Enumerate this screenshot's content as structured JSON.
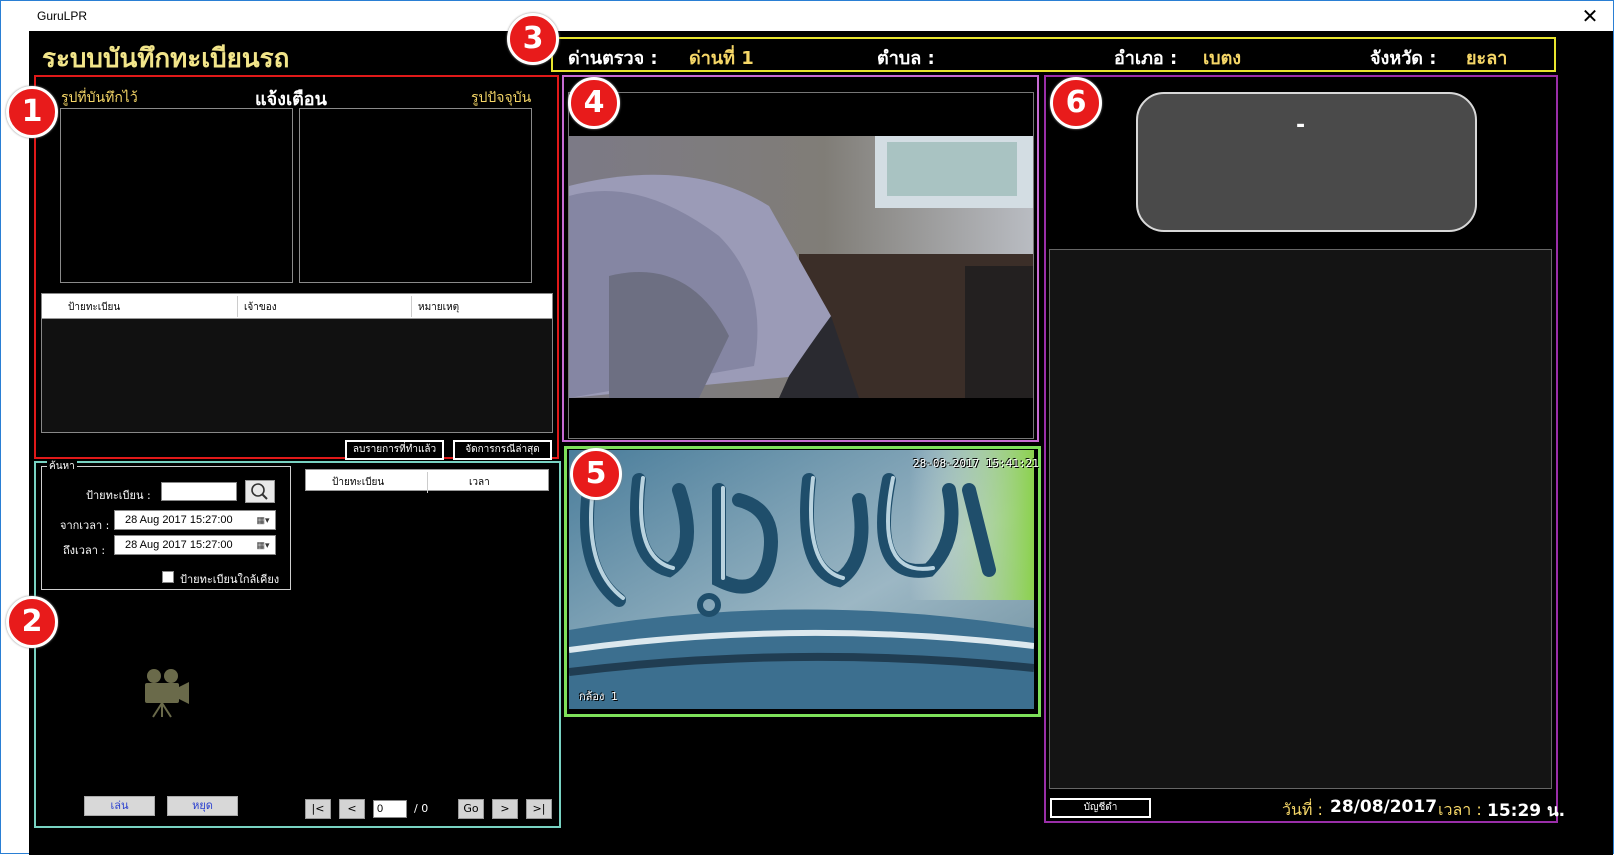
{
  "window": {
    "title": "GuruLPR",
    "close_glyph": "✕"
  },
  "app": {
    "title": "ระบบบันทึกทะเบียนรถ"
  },
  "location": {
    "checkpoint_label": "ด่านตรวจ :",
    "checkpoint_value": "ด่านที่ 1",
    "subdistrict_label": "ตำบล :",
    "subdistrict_value": "",
    "district_label": "อำเภอ :",
    "district_value": "เบตง",
    "province_label": "จังหวัด :",
    "province_value": "ยะลา"
  },
  "callouts": [
    "1",
    "2",
    "3",
    "4",
    "5",
    "6"
  ],
  "alert": {
    "saved_image_label": "รูปที่บันทึกไว้",
    "title": "แจ้งเตือน",
    "current_image_label": "รูปปัจจุบัน",
    "columns": [
      "ป้ายทะเบียน",
      "เจ้าของ",
      "หมายเหตุ"
    ],
    "delete_done_button": "ลบรายการที่ทำแล้ว",
    "manage_latest_button": "จัดการกรณีล่าสุด"
  },
  "search": {
    "group_title": "ค้นหา",
    "plate_label": "ป้ายทะเบียน :",
    "plate_value": "",
    "from_label": "จากเวลา :",
    "from_value": "28 Aug 2017   15:27:00",
    "to_label": "ถึงเวลา :",
    "to_value": "28 Aug 2017   15:27:00",
    "similar_plate_label": "ป้ายทะเบียนใกล้เคียง",
    "result_columns": [
      "ป้ายทะเบียน",
      "เวลา"
    ],
    "play_button": "เล่น",
    "stop_button": "หยุด",
    "first_button": "|<",
    "prev_button": "<",
    "page_value": "0",
    "page_total": "/ 0",
    "go_button": "Go",
    "next_button": ">",
    "last_button": ">|"
  },
  "camera": {
    "timestamp": "28-08-2017 15:41:21",
    "name": "กล้อง 1"
  },
  "plate_panel": {
    "plate_text": "-",
    "blacklist_button": "บัญชีดำ",
    "date_label": "วันที่ :",
    "date_value": "28/08/2017",
    "time_label": "เวลา :",
    "time_value": "15:29 น."
  },
  "colors": {
    "panel1": "#e01919",
    "panel2": "#78d2c2",
    "panel3": "#e8e52d",
    "panel4": "#c76bd3",
    "panel5": "#7ee05a",
    "panel6": "#9a2ea8",
    "callout": "#e81b1b",
    "accent_yellow": "#f5d667"
  },
  "icons": [
    "close-icon",
    "search-icon",
    "calendar-icon",
    "video-camera-icon"
  ]
}
